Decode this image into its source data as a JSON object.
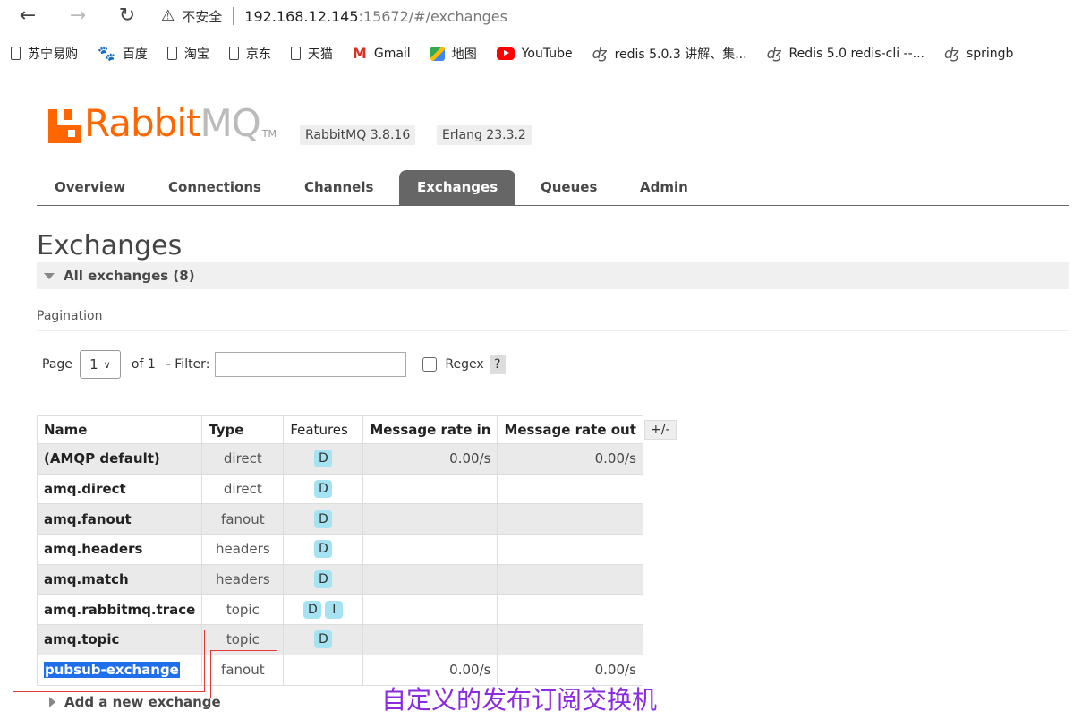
{
  "browser": {
    "insecure_label": "不安全",
    "url_host": "192.168.12.145",
    "url_rest": ":15672/#/exchanges",
    "bookmarks": [
      {
        "label": "苏宁易购",
        "icon": "doc-icon"
      },
      {
        "label": "百度",
        "icon": "paw-icon"
      },
      {
        "label": "淘宝",
        "icon": "doc-icon"
      },
      {
        "label": "京东",
        "icon": "doc-icon"
      },
      {
        "label": "天猫",
        "icon": "doc-icon"
      },
      {
        "label": "Gmail",
        "icon": "gmail-icon"
      },
      {
        "label": "地图",
        "icon": "maps-icon"
      },
      {
        "label": "YouTube",
        "icon": "youtube-icon"
      },
      {
        "label": "redis 5.0.3 讲解、集...",
        "icon": "csdn-icon"
      },
      {
        "label": "Redis 5.0 redis-cli --...",
        "icon": "csdn-icon"
      },
      {
        "label": "springb",
        "icon": "csdn-icon"
      }
    ]
  },
  "app": {
    "logo_rabbit": "Rabbit",
    "logo_mq": "MQ",
    "logo_tm": "TM",
    "rabbit_version": "RabbitMQ 3.8.16",
    "erlang_version": "Erlang 23.3.2",
    "brand_color": "#ff6600"
  },
  "tabs": [
    {
      "label": "Overview",
      "active": false
    },
    {
      "label": "Connections",
      "active": false
    },
    {
      "label": "Channels",
      "active": false
    },
    {
      "label": "Exchanges",
      "active": true
    },
    {
      "label": "Queues",
      "active": false
    },
    {
      "label": "Admin",
      "active": false
    }
  ],
  "page": {
    "title": "Exchanges",
    "section_label": "All exchanges (8)",
    "pagination_label": "Pagination",
    "page_label": "Page",
    "page_value": "1",
    "of_label": "of 1",
    "filter_label": "- Filter:",
    "filter_value": "",
    "regex_label": "Regex",
    "help_label": "?",
    "toggle_columns": "+/-",
    "add_exchange": "Add a new exchange"
  },
  "table": {
    "headers": [
      "Name",
      "Type",
      "Features",
      "Message rate in",
      "Message rate out"
    ],
    "rows": [
      {
        "name": "(AMQP default)",
        "type": "direct",
        "features": [
          "D"
        ],
        "rate_in": "0.00/s",
        "rate_out": "0.00/s"
      },
      {
        "name": "amq.direct",
        "type": "direct",
        "features": [
          "D"
        ],
        "rate_in": "",
        "rate_out": ""
      },
      {
        "name": "amq.fanout",
        "type": "fanout",
        "features": [
          "D"
        ],
        "rate_in": "",
        "rate_out": ""
      },
      {
        "name": "amq.headers",
        "type": "headers",
        "features": [
          "D"
        ],
        "rate_in": "",
        "rate_out": ""
      },
      {
        "name": "amq.match",
        "type": "headers",
        "features": [
          "D"
        ],
        "rate_in": "",
        "rate_out": ""
      },
      {
        "name": "amq.rabbitmq.trace",
        "type": "topic",
        "features": [
          "D",
          "I"
        ],
        "rate_in": "",
        "rate_out": ""
      },
      {
        "name": "amq.topic",
        "type": "topic",
        "features": [
          "D"
        ],
        "rate_in": "",
        "rate_out": ""
      },
      {
        "name": "pubsub-exchange",
        "type": "fanout",
        "features": [],
        "rate_in": "0.00/s",
        "rate_out": "0.00/s"
      }
    ]
  },
  "annotation": {
    "text": "自定义的发布订阅交换机"
  }
}
